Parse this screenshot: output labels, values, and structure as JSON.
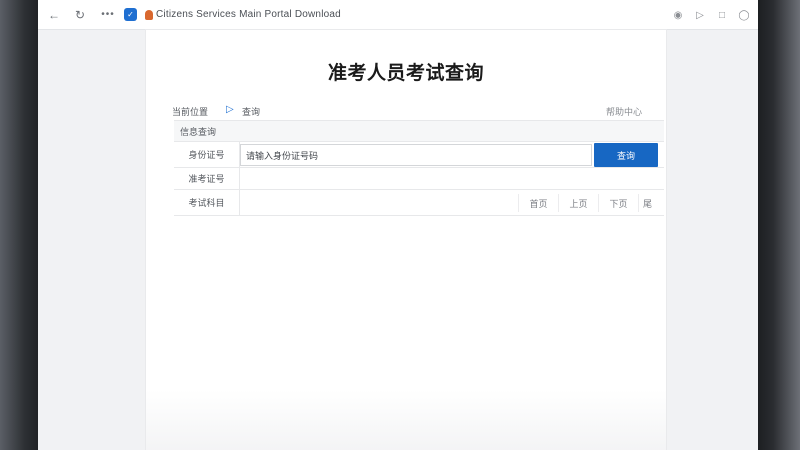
{
  "browser": {
    "address_text": "Citizens Services Main Portal Download",
    "icons": [
      "back-icon",
      "refresh-icon",
      "more-icon",
      "shield-icon",
      "favicon",
      "extension-icon",
      "play-icon",
      "tab-icon",
      "menu-icon"
    ]
  },
  "page": {
    "title": "准考人员考试查询",
    "info": {
      "breadcrumb": "当前位置",
      "count": "查询",
      "right_note": "帮助中心"
    },
    "form": {
      "header_label": "信息查询",
      "rows": [
        {
          "label": "身份证号",
          "value": "请输入身份证号码"
        },
        {
          "label": "准考证号",
          "value": ""
        },
        {
          "label": "考试科目",
          "value": ""
        }
      ],
      "query_button_label": "查询",
      "pager": [
        "首页",
        "上页",
        "下页",
        "尾"
      ]
    }
  },
  "colors": {
    "accent": "#1767c3",
    "bezel": "#2c2f33"
  }
}
